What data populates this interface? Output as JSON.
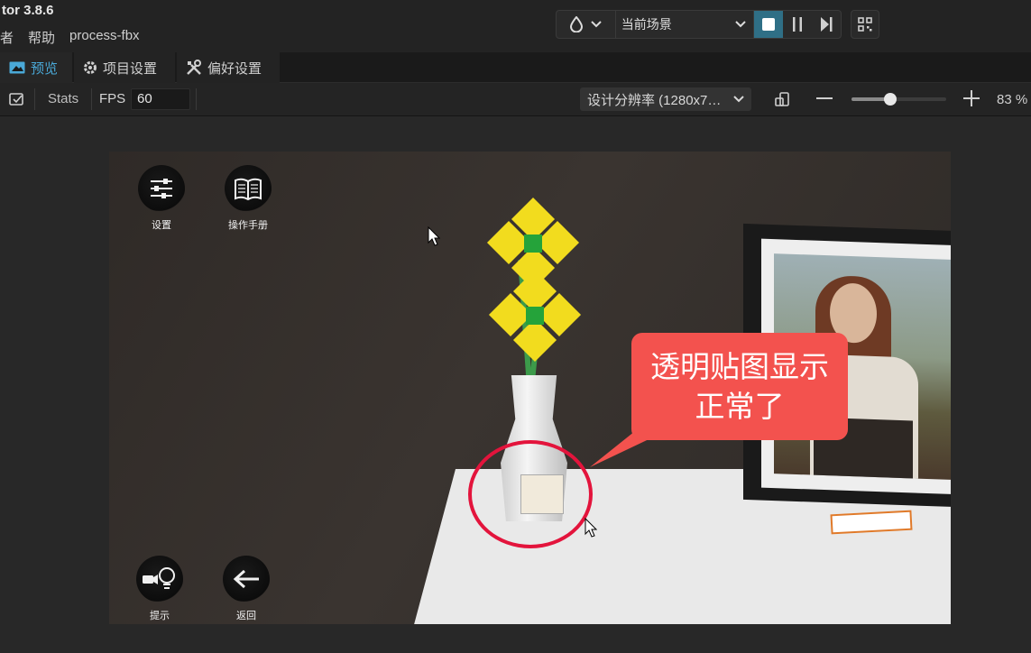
{
  "titlebar": {
    "app_title": "tor 3.8.6",
    "menu": [
      "者",
      "帮助",
      "process-fbx"
    ]
  },
  "play_controls": {
    "scene_label": "当前场景"
  },
  "tabs": [
    {
      "label": "预览",
      "active": true
    },
    {
      "label": "项目设置",
      "active": false
    },
    {
      "label": "偏好设置",
      "active": false
    }
  ],
  "toolbar": {
    "stats_label": "Stats",
    "fps_label": "FPS",
    "fps_value": "60",
    "resolution": "设计分辨率 (1280x7…",
    "zoom_percent": "83 %",
    "zoom_level": 0.41
  },
  "game": {
    "buttons": {
      "settings": "设置",
      "manual": "操作手册",
      "hint": "提示",
      "back": "返回"
    },
    "annotation": "透明贴图显示正常了"
  },
  "colors": {
    "accent": "#4aa9d8",
    "stop_button": "#2f6f86",
    "bubble": "#f3524e",
    "highlight_circle": "#e3143c"
  }
}
